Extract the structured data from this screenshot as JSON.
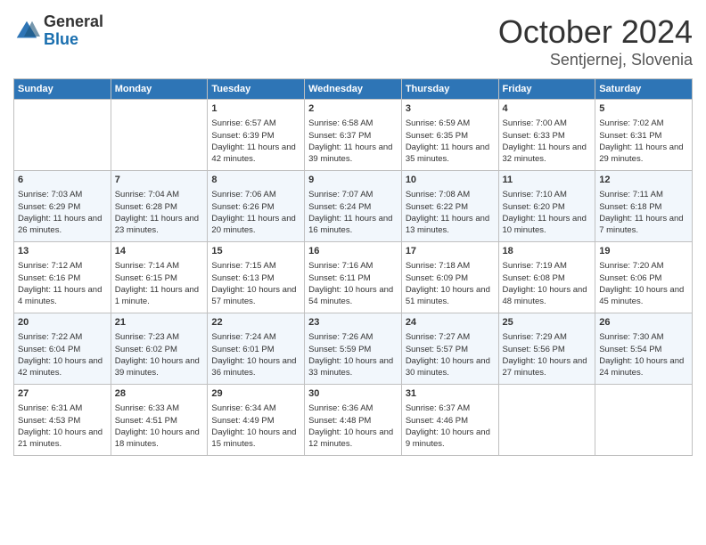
{
  "header": {
    "logo": {
      "general": "General",
      "blue": "Blue"
    },
    "title": "October 2024",
    "subtitle": "Sentjernej, Slovenia"
  },
  "weekdays": [
    "Sunday",
    "Monday",
    "Tuesday",
    "Wednesday",
    "Thursday",
    "Friday",
    "Saturday"
  ],
  "weeks": [
    [
      null,
      null,
      {
        "day": "1",
        "sunrise": "6:57 AM",
        "sunset": "6:39 PM",
        "daylight": "11 hours and 42 minutes."
      },
      {
        "day": "2",
        "sunrise": "6:58 AM",
        "sunset": "6:37 PM",
        "daylight": "11 hours and 39 minutes."
      },
      {
        "day": "3",
        "sunrise": "6:59 AM",
        "sunset": "6:35 PM",
        "daylight": "11 hours and 35 minutes."
      },
      {
        "day": "4",
        "sunrise": "7:00 AM",
        "sunset": "6:33 PM",
        "daylight": "11 hours and 32 minutes."
      },
      {
        "day": "5",
        "sunrise": "7:02 AM",
        "sunset": "6:31 PM",
        "daylight": "11 hours and 29 minutes."
      }
    ],
    [
      {
        "day": "6",
        "sunrise": "7:03 AM",
        "sunset": "6:29 PM",
        "daylight": "11 hours and 26 minutes."
      },
      {
        "day": "7",
        "sunrise": "7:04 AM",
        "sunset": "6:28 PM",
        "daylight": "11 hours and 23 minutes."
      },
      {
        "day": "8",
        "sunrise": "7:06 AM",
        "sunset": "6:26 PM",
        "daylight": "11 hours and 20 minutes."
      },
      {
        "day": "9",
        "sunrise": "7:07 AM",
        "sunset": "6:24 PM",
        "daylight": "11 hours and 16 minutes."
      },
      {
        "day": "10",
        "sunrise": "7:08 AM",
        "sunset": "6:22 PM",
        "daylight": "11 hours and 13 minutes."
      },
      {
        "day": "11",
        "sunrise": "7:10 AM",
        "sunset": "6:20 PM",
        "daylight": "11 hours and 10 minutes."
      },
      {
        "day": "12",
        "sunrise": "7:11 AM",
        "sunset": "6:18 PM",
        "daylight": "11 hours and 7 minutes."
      }
    ],
    [
      {
        "day": "13",
        "sunrise": "7:12 AM",
        "sunset": "6:16 PM",
        "daylight": "11 hours and 4 minutes."
      },
      {
        "day": "14",
        "sunrise": "7:14 AM",
        "sunset": "6:15 PM",
        "daylight": "11 hours and 1 minute."
      },
      {
        "day": "15",
        "sunrise": "7:15 AM",
        "sunset": "6:13 PM",
        "daylight": "10 hours and 57 minutes."
      },
      {
        "day": "16",
        "sunrise": "7:16 AM",
        "sunset": "6:11 PM",
        "daylight": "10 hours and 54 minutes."
      },
      {
        "day": "17",
        "sunrise": "7:18 AM",
        "sunset": "6:09 PM",
        "daylight": "10 hours and 51 minutes."
      },
      {
        "day": "18",
        "sunrise": "7:19 AM",
        "sunset": "6:08 PM",
        "daylight": "10 hours and 48 minutes."
      },
      {
        "day": "19",
        "sunrise": "7:20 AM",
        "sunset": "6:06 PM",
        "daylight": "10 hours and 45 minutes."
      }
    ],
    [
      {
        "day": "20",
        "sunrise": "7:22 AM",
        "sunset": "6:04 PM",
        "daylight": "10 hours and 42 minutes."
      },
      {
        "day": "21",
        "sunrise": "7:23 AM",
        "sunset": "6:02 PM",
        "daylight": "10 hours and 39 minutes."
      },
      {
        "day": "22",
        "sunrise": "7:24 AM",
        "sunset": "6:01 PM",
        "daylight": "10 hours and 36 minutes."
      },
      {
        "day": "23",
        "sunrise": "7:26 AM",
        "sunset": "5:59 PM",
        "daylight": "10 hours and 33 minutes."
      },
      {
        "day": "24",
        "sunrise": "7:27 AM",
        "sunset": "5:57 PM",
        "daylight": "10 hours and 30 minutes."
      },
      {
        "day": "25",
        "sunrise": "7:29 AM",
        "sunset": "5:56 PM",
        "daylight": "10 hours and 27 minutes."
      },
      {
        "day": "26",
        "sunrise": "7:30 AM",
        "sunset": "5:54 PM",
        "daylight": "10 hours and 24 minutes."
      }
    ],
    [
      {
        "day": "27",
        "sunrise": "6:31 AM",
        "sunset": "4:53 PM",
        "daylight": "10 hours and 21 minutes."
      },
      {
        "day": "28",
        "sunrise": "6:33 AM",
        "sunset": "4:51 PM",
        "daylight": "10 hours and 18 minutes."
      },
      {
        "day": "29",
        "sunrise": "6:34 AM",
        "sunset": "4:49 PM",
        "daylight": "10 hours and 15 minutes."
      },
      {
        "day": "30",
        "sunrise": "6:36 AM",
        "sunset": "4:48 PM",
        "daylight": "10 hours and 12 minutes."
      },
      {
        "day": "31",
        "sunrise": "6:37 AM",
        "sunset": "4:46 PM",
        "daylight": "10 hours and 9 minutes."
      },
      null,
      null
    ]
  ],
  "labels": {
    "sunrise": "Sunrise:",
    "sunset": "Sunset:",
    "daylight": "Daylight:"
  }
}
